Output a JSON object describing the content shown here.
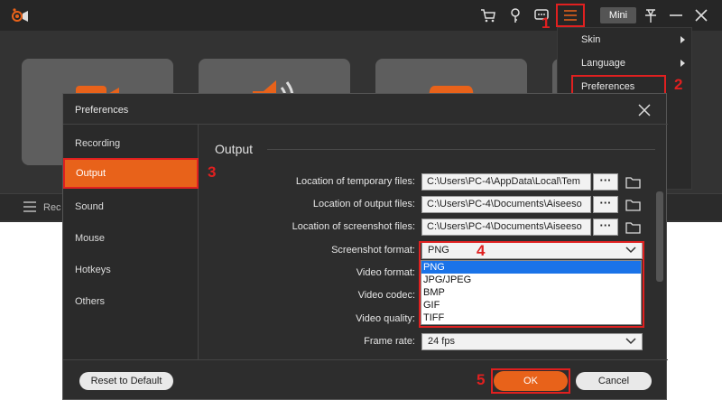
{
  "app": {
    "logo_icon": "record-camera-logo-icon",
    "toolbar_icons": [
      "cart-icon",
      "key-icon",
      "chat-icon",
      "menu-icon"
    ],
    "mini_label": "Mini",
    "window_icons": [
      "pin-icon",
      "minimize-icon",
      "close-icon"
    ],
    "bottom_bar_label": "Rec"
  },
  "app_menu": {
    "items": [
      {
        "label": "Skin",
        "has_submenu": true
      },
      {
        "label": "Language",
        "has_submenu": true
      },
      {
        "label": "Preferences",
        "has_submenu": false
      }
    ]
  },
  "annotations": [
    "1",
    "2",
    "3",
    "4",
    "5"
  ],
  "dialog": {
    "title": "Preferences",
    "sidebar": {
      "items": [
        {
          "label": "Recording"
        },
        {
          "label": "Output"
        },
        {
          "label": "Sound"
        },
        {
          "label": "Mouse"
        },
        {
          "label": "Hotkeys"
        },
        {
          "label": "Others"
        }
      ],
      "active": "Output"
    },
    "section_title": "Output",
    "fields": {
      "temp_label": "Location of temporary files:",
      "temp_value": "C:\\Users\\PC-4\\AppData\\Local\\Tem",
      "output_label": "Location of output files:",
      "output_value": "C:\\Users\\PC-4\\Documents\\Aiseeso",
      "screenshot_label": "Location of screenshot files:",
      "screenshot_value": "C:\\Users\\PC-4\\Documents\\Aiseeso",
      "browse_label": "···",
      "format_label": "Screenshot format:",
      "format_value": "PNG",
      "video_format_label": "Video format:",
      "video_codec_label": "Video codec:",
      "video_quality_label": "Video quality:",
      "frame_rate_label": "Frame rate:",
      "frame_rate_value": "24 fps"
    },
    "format_options": [
      "PNG",
      "JPG/JPEG",
      "BMP",
      "GIF",
      "TIFF"
    ],
    "format_selected": "PNG",
    "buttons": {
      "reset": "Reset to Default",
      "ok": "OK",
      "cancel": "Cancel"
    }
  },
  "colors": {
    "accent": "#e8621a",
    "highlight_border": "#e02020",
    "selection": "#1a73e8"
  }
}
